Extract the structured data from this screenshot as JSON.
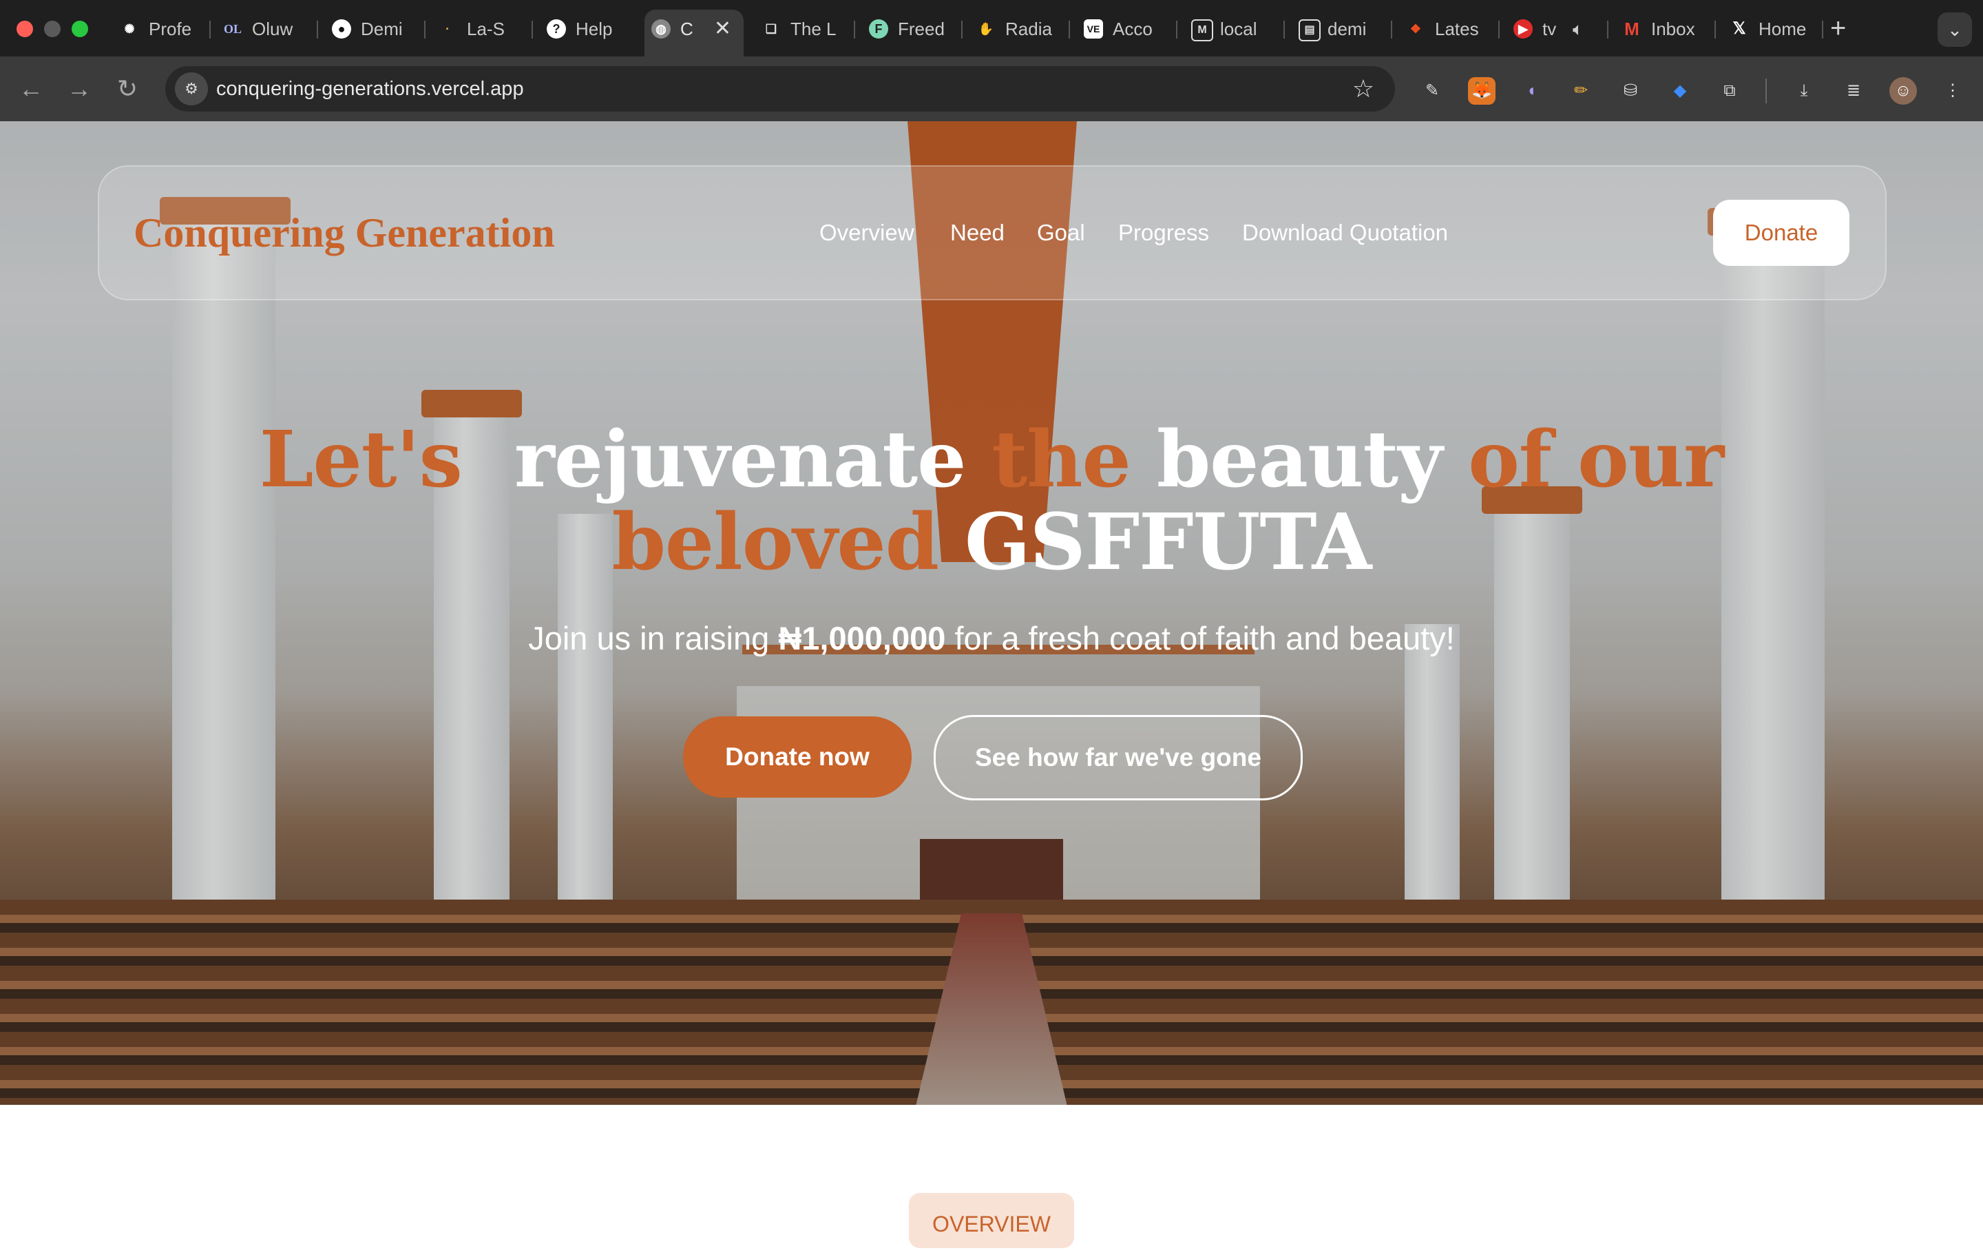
{
  "browser": {
    "tabs": [
      {
        "title": "Profe",
        "icon": "openai-icon"
      },
      {
        "title": "Oluw",
        "icon": "openlibrary-icon",
        "glyph": "OL"
      },
      {
        "title": "Demi",
        "icon": "github-icon"
      },
      {
        "title": "La-S",
        "icon": "dot-icon"
      },
      {
        "title": "Help",
        "icon": "help-icon"
      },
      {
        "title": "C",
        "icon": "globe-icon",
        "active": true
      },
      {
        "title": "The L",
        "icon": "book-icon"
      },
      {
        "title": "Freed",
        "icon": "freedium-icon"
      },
      {
        "title": "Radia",
        "icon": "radiant-icon"
      },
      {
        "title": "Acco",
        "icon": "account-icon"
      },
      {
        "title": "local",
        "icon": "localhost-icon"
      },
      {
        "title": "demi",
        "icon": "document-icon"
      },
      {
        "title": "Lates",
        "icon": "figma-icon"
      },
      {
        "title": "tv",
        "icon": "youtube-icon"
      },
      {
        "title": "Inbox",
        "icon": "gmail-icon"
      },
      {
        "title": "Home",
        "icon": "x-icon"
      }
    ],
    "url": "conquering-generations.vercel.app"
  },
  "site": {
    "brand": "Conquering Generation",
    "nav": [
      "Overview",
      "Need",
      "Goal",
      "Progress",
      "Download Quotation"
    ],
    "nav_donate": "Donate",
    "headline": {
      "w1": "Let's",
      "w2": "rejuvenate",
      "w3": "the",
      "w4": "beauty",
      "w5": "of our",
      "w6": "beloved",
      "w7": "GSFFUTA"
    },
    "sub_prefix": "Join us in raising",
    "sub_amount": "₦1,000,000",
    "sub_suffix": "for a fresh coat of faith and beauty!",
    "cta_primary": "Donate now",
    "cta_secondary": "See how far we've gone",
    "section_label": "OVERVIEW"
  },
  "colors": {
    "accent": "#c8632b",
    "chrome_dark": "#1f1f1f",
    "toolbar": "#3b3b3b",
    "pill_bg": "#f8e2d6"
  }
}
